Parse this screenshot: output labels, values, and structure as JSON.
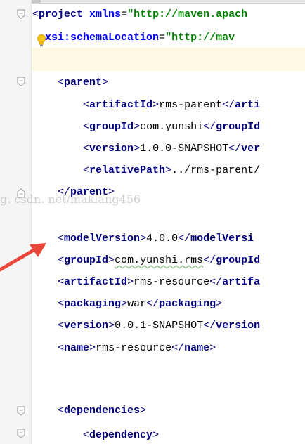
{
  "colors": {
    "tag": "#000080",
    "attribute": "#0000ff",
    "string": "#008000",
    "text": "#000000",
    "highlight": "#fffae3",
    "arrow": "#e8473a"
  },
  "icons": {
    "intention": "lightbulb-icon",
    "fold": "fold-marker-icon",
    "annotation": "red-arrow-icon"
  },
  "watermark": "g. csdn. net/maklang456",
  "lines": [
    {
      "l1": "<",
      "tag": "project",
      "sp1": " ",
      "attr": "xmlns",
      "eq": "=",
      "val": "\"http://maven.apach"
    },
    {
      "ind": "  ",
      "attr": "xsi:schemaLocation",
      "eq": "=",
      "val": "\"http://mav"
    },
    {
      "blank": ""
    },
    {
      "ind": "    ",
      "l1": "<",
      "tag": "parent",
      "r1": ">"
    },
    {
      "ind": "        ",
      "l1": "<",
      "tag": "artifactId",
      "r1": ">",
      "text": "rms-parent",
      "l2": "</",
      "tag2": "arti"
    },
    {
      "ind": "        ",
      "l1": "<",
      "tag": "groupId",
      "r1": ">",
      "text": "com.yunshi",
      "l2": "</",
      "tag2": "groupId"
    },
    {
      "ind": "        ",
      "l1": "<",
      "tag": "version",
      "r1": ">",
      "text": "1.0.0-SNAPSHOT",
      "l2": "</",
      "tag2": "ver"
    },
    {
      "ind": "        ",
      "l1": "<",
      "tag": "relativePath",
      "r1": ">",
      "text": "../rms-parent/"
    },
    {
      "ind": "    ",
      "l1": "</",
      "tag": "parent",
      "r1": ">"
    },
    {
      "blank": ""
    },
    {
      "ind": "    ",
      "l1": "<",
      "tag": "modelVersion",
      "r1": ">",
      "text": "4.0.0",
      "l2": "</",
      "tag2": "modelVersi"
    },
    {
      "ind": "    ",
      "l1": "<",
      "tag": "groupId",
      "r1": ">",
      "text": "com.yunshi.rms",
      "l2": "</",
      "tag2": "groupId"
    },
    {
      "ind": "    ",
      "l1": "<",
      "tag": "artifactId",
      "r1": ">",
      "text": "rms-resource",
      "l2": "</",
      "tag2": "artifa"
    },
    {
      "ind": "    ",
      "l1": "<",
      "tag": "packaging",
      "r1": ">",
      "text": "war",
      "l2": "</",
      "tag2": "packaging",
      "r2": ">"
    },
    {
      "ind": "    ",
      "l1": "<",
      "tag": "version",
      "r1": ">",
      "text": "0.0.1-SNAPSHOT",
      "l2": "</",
      "tag2": "version"
    },
    {
      "ind": "    ",
      "l1": "<",
      "tag": "name",
      "r1": ">",
      "text": "rms-resource",
      "l2": "</",
      "tag2": "name",
      "r2": ">"
    },
    {
      "blank": ""
    },
    {
      "blank": ""
    },
    {
      "blank": ""
    },
    {
      "ind": "    ",
      "l1": "<",
      "tag": "dependencies",
      "r1": ">"
    },
    {
      "ind": "        ",
      "l1": "<",
      "tag": "dependency",
      "r1": ">"
    }
  ]
}
